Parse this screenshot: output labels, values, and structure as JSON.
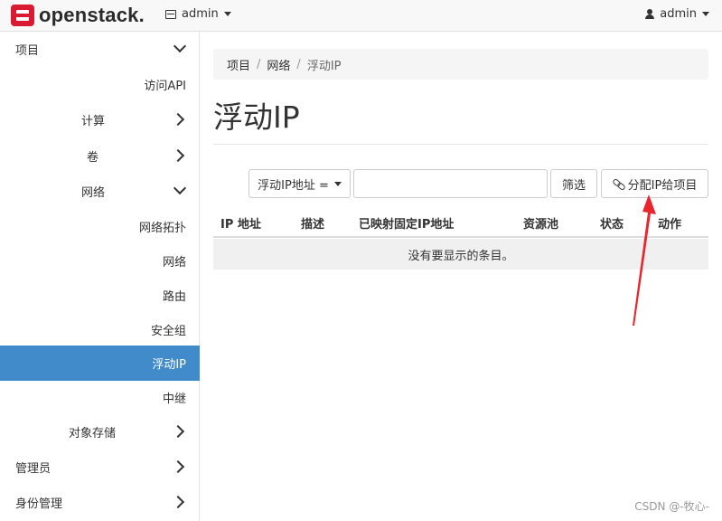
{
  "topbar": {
    "logo_text": "openstack.",
    "project_label": "admin",
    "user_label": "admin"
  },
  "sidebar": {
    "items": [
      {
        "label": "项目",
        "chevron": "down",
        "active": false
      },
      {
        "label": "访问API",
        "chevron": "",
        "active": false
      },
      {
        "label": "计算",
        "chevron": "right",
        "active": false
      },
      {
        "label": "卷",
        "chevron": "right",
        "active": false
      },
      {
        "label": "网络",
        "chevron": "down",
        "active": false
      },
      {
        "label": "网络拓扑",
        "chevron": "",
        "active": false
      },
      {
        "label": "网络",
        "chevron": "",
        "active": false
      },
      {
        "label": "路由",
        "chevron": "",
        "active": false
      },
      {
        "label": "安全组",
        "chevron": "",
        "active": false
      },
      {
        "label": "浮动IP",
        "chevron": "",
        "active": true
      },
      {
        "label": "中继",
        "chevron": "",
        "active": false
      },
      {
        "label": "对象存储",
        "chevron": "right",
        "active": false
      },
      {
        "label": "管理员",
        "chevron": "right",
        "active": false
      },
      {
        "label": "身份管理",
        "chevron": "right",
        "active": false
      }
    ]
  },
  "breadcrumb": {
    "items": [
      "项目",
      "网络",
      "浮动IP"
    ]
  },
  "page_title": "浮动IP",
  "filter": {
    "dropdown_label": "浮动IP地址 =",
    "input_value": "",
    "filter_button": "筛选",
    "allocate_button": "分配IP给项目"
  },
  "table": {
    "columns": [
      "IP 地址",
      "描述",
      "已映射固定IP地址",
      "资源池",
      "状态",
      "动作"
    ],
    "empty_message": "没有要显示的条目。"
  },
  "annotation": {
    "arrow_color": "#e8262c"
  },
  "watermark": "CSDN @-牧心-",
  "colors": {
    "brand": "#da1a32",
    "active_nav": "#428bca"
  }
}
